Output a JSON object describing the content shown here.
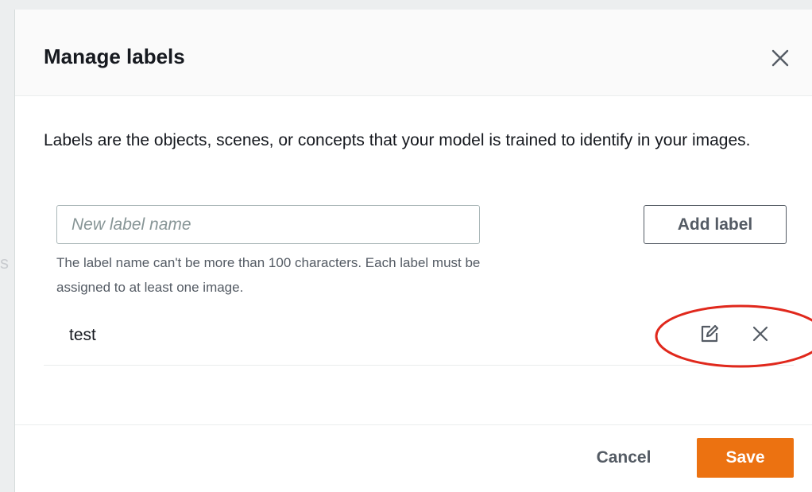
{
  "modal": {
    "title": "Manage labels",
    "description": "Labels are the objects, scenes, or concepts that your model is trained to identify in your images."
  },
  "new_label": {
    "value": "",
    "placeholder": "New label name",
    "hint": "The label name can't be more than 100 characters. Each label must be assigned to at least one image.",
    "add_label": "Add label"
  },
  "labels": [
    {
      "name": "test"
    }
  ],
  "footer": {
    "cancel_label": "Cancel",
    "save_label": "Save"
  },
  "icons": {
    "close": "close-icon",
    "edit": "edit-icon",
    "delete": "delete-icon"
  },
  "colors": {
    "primary": "#ec7211",
    "highlight": "#e0281c",
    "text": "#16191f",
    "secondary_text": "#545b64"
  }
}
